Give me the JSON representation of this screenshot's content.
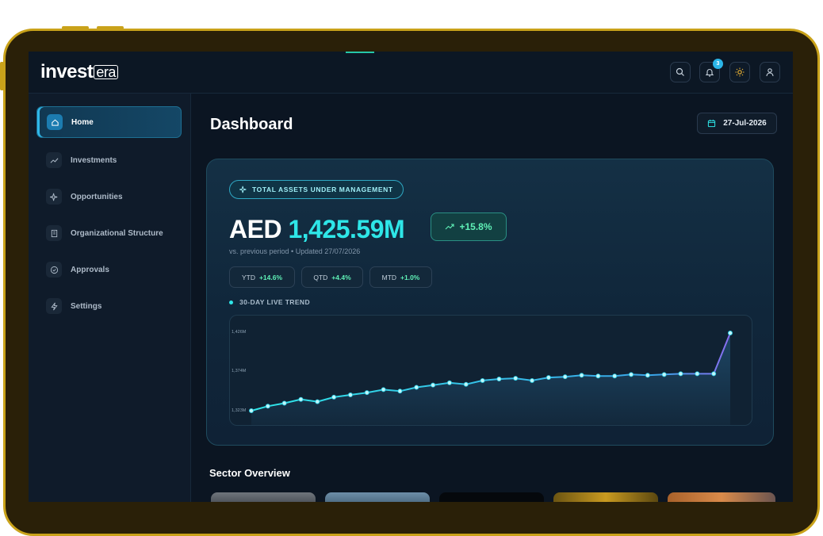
{
  "app": {
    "logo_main": "invest",
    "logo_suffix": "era",
    "notification_count": "3"
  },
  "topbar": {
    "icons": [
      "search-icon",
      "bell-icon",
      "sun-icon",
      "user-icon"
    ]
  },
  "sidebar": {
    "items": [
      {
        "label": "Home",
        "icon": "home-icon",
        "active": true
      },
      {
        "label": "Investments",
        "icon": "trend-icon",
        "active": false
      },
      {
        "label": "Opportunities",
        "icon": "sparkle-icon",
        "active": false
      },
      {
        "label": "Organizational Structure",
        "icon": "building-icon",
        "active": false
      },
      {
        "label": "Approvals",
        "icon": "check-circle-icon",
        "active": false
      },
      {
        "label": "Settings",
        "icon": "bolt-icon",
        "active": false
      }
    ]
  },
  "header": {
    "title": "Dashboard",
    "date": "27-Jul-2026"
  },
  "assets": {
    "tag": "TOTAL ASSETS UNDER MANAGEMENT",
    "currency": "AED",
    "value": "1,425.59M",
    "delta": "+15.8%",
    "subline": "vs. previous period • Updated 27/07/2026",
    "periods": [
      {
        "key": "YTD",
        "value": "+14.6%"
      },
      {
        "key": "QTD",
        "value": "+4.4%"
      },
      {
        "key": "MTD",
        "value": "+1.0%"
      }
    ],
    "trend_label": "30-DAY LIVE TREND"
  },
  "chart_data": {
    "type": "area",
    "title": "30-DAY LIVE TREND",
    "y_ticks": [
      "1,426M",
      "1,374M",
      "1,323M"
    ],
    "ylim": [
      1323,
      1426
    ],
    "x": [
      1,
      2,
      3,
      4,
      5,
      6,
      7,
      8,
      9,
      10,
      11,
      12,
      13,
      14,
      15,
      16,
      17,
      18,
      19,
      20,
      21,
      22,
      23,
      24,
      25,
      26,
      27,
      28,
      29,
      30
    ],
    "values": [
      1323,
      1329,
      1333,
      1338,
      1335,
      1341,
      1344,
      1347,
      1351,
      1349,
      1354,
      1357,
      1360,
      1358,
      1363,
      1365,
      1366,
      1363,
      1367,
      1368,
      1370,
      1369,
      1369,
      1371,
      1370,
      1371,
      1372,
      1372,
      1372,
      1426
    ],
    "colors": {
      "line_start": "#2ee6e8",
      "line_end": "#8a6cf0",
      "fill": "#1f4a6a"
    }
  },
  "sector": {
    "title": "Sector Overview"
  },
  "colors": {
    "accent": "#2ee6e8",
    "positive": "#5ff0b6",
    "bezel": "#c9a21a"
  }
}
